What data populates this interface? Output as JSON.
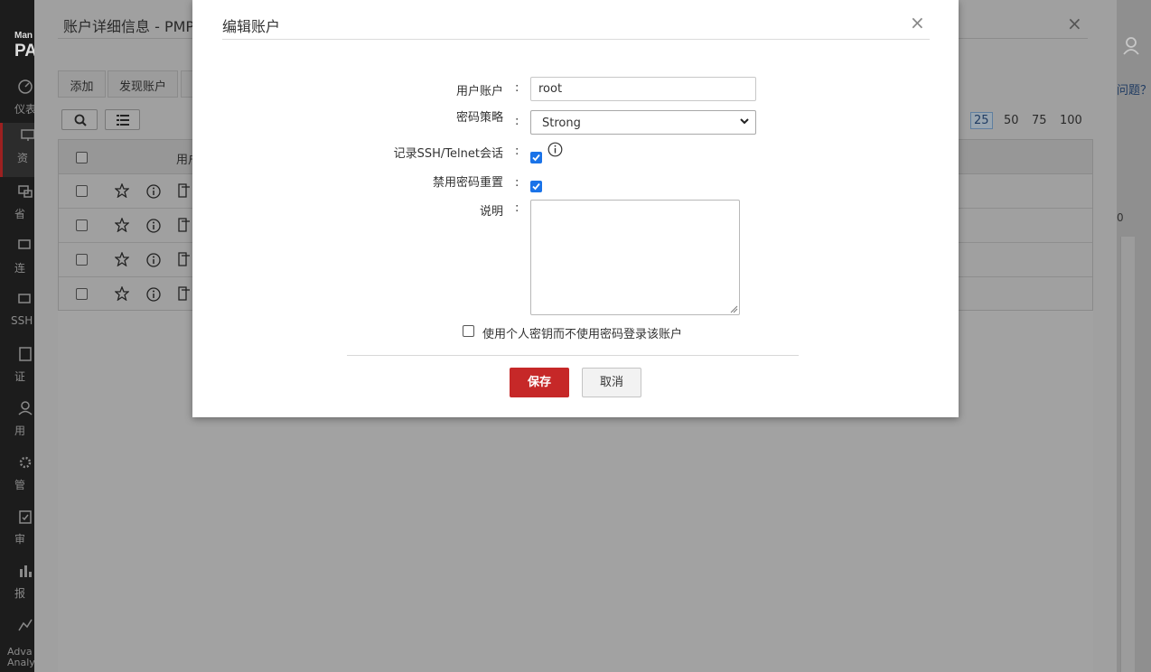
{
  "app": {
    "brand_small": "Man",
    "brand_big": "PAM",
    "help_link": "问题？",
    "count_fragment": "0",
    "nav": [
      {
        "label": "仪表"
      },
      {
        "label": "资"
      },
      {
        "label": "省"
      },
      {
        "label": "连"
      },
      {
        "label": "SSH"
      },
      {
        "label": "证"
      },
      {
        "label": "用"
      },
      {
        "label": "管"
      },
      {
        "label": "审"
      },
      {
        "label": "报"
      },
      {
        "label": "Adva",
        "label2": "Analy"
      }
    ]
  },
  "account_details": {
    "title": "账户详细信息 - PMP",
    "close": "×",
    "buttons": {
      "add": "添加",
      "discover": "发现账户"
    },
    "pager": [
      "25",
      "50",
      "75",
      "100"
    ],
    "pager_active": "25",
    "table": {
      "header_user": "用户"
    },
    "row_count": 4
  },
  "edit_modal": {
    "title": "编辑账户",
    "close": "×",
    "fields": {
      "user_account": {
        "label": "用户账户",
        "value": "root"
      },
      "password_policy": {
        "label": "密码策略",
        "value": "Strong"
      },
      "record_session": {
        "label": "记录SSH/Telnet会话",
        "checked": true
      },
      "disable_reset": {
        "label": "禁用密码重置",
        "checked": true
      },
      "description": {
        "label": "说明",
        "value": ""
      }
    },
    "colon": ":",
    "private_key_option": {
      "label": "使用个人密钥而不使用密码登录该账户",
      "checked": false
    },
    "save_button": "保存",
    "cancel_button": "取消"
  },
  "colors": {
    "accent_red": "#c62828",
    "checkbox_blue": "#1a73e8"
  }
}
